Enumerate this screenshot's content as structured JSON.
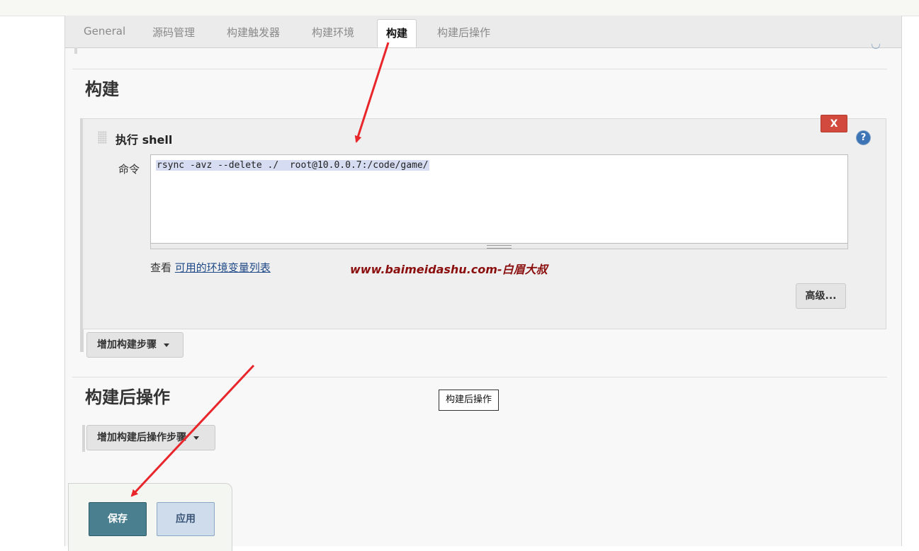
{
  "tabs": [
    {
      "label": "General"
    },
    {
      "label": "源码管理"
    },
    {
      "label": "构建触发器"
    },
    {
      "label": "构建环境"
    },
    {
      "label": "构建",
      "active": true
    },
    {
      "label": "构建后操作"
    }
  ],
  "build": {
    "section_title": "构建",
    "step": {
      "title": "执行 shell",
      "delete_label": "X",
      "help_label": "?",
      "command_label": "命令",
      "command_value": "rsync -avz --delete ./  root@10.0.0.7:/code/game/",
      "env_prefix": "查看",
      "env_link": "可用的环境变量列表",
      "advanced_label": "高级..."
    },
    "add_step_label": "增加构建步骤"
  },
  "watermark": "www.baimeidashu.com-白眉大叔",
  "post_build": {
    "section_title": "构建后操作",
    "tooltip": "构建后操作",
    "add_step_label": "增加构建后操作步骤"
  },
  "footer": {
    "save_label": "保存",
    "apply_label": "应用"
  },
  "colors": {
    "annotation_arrow": "#e8262b",
    "save_button": "#4a7f90",
    "delete_button": "#d24a3d",
    "link": "#204a87"
  }
}
